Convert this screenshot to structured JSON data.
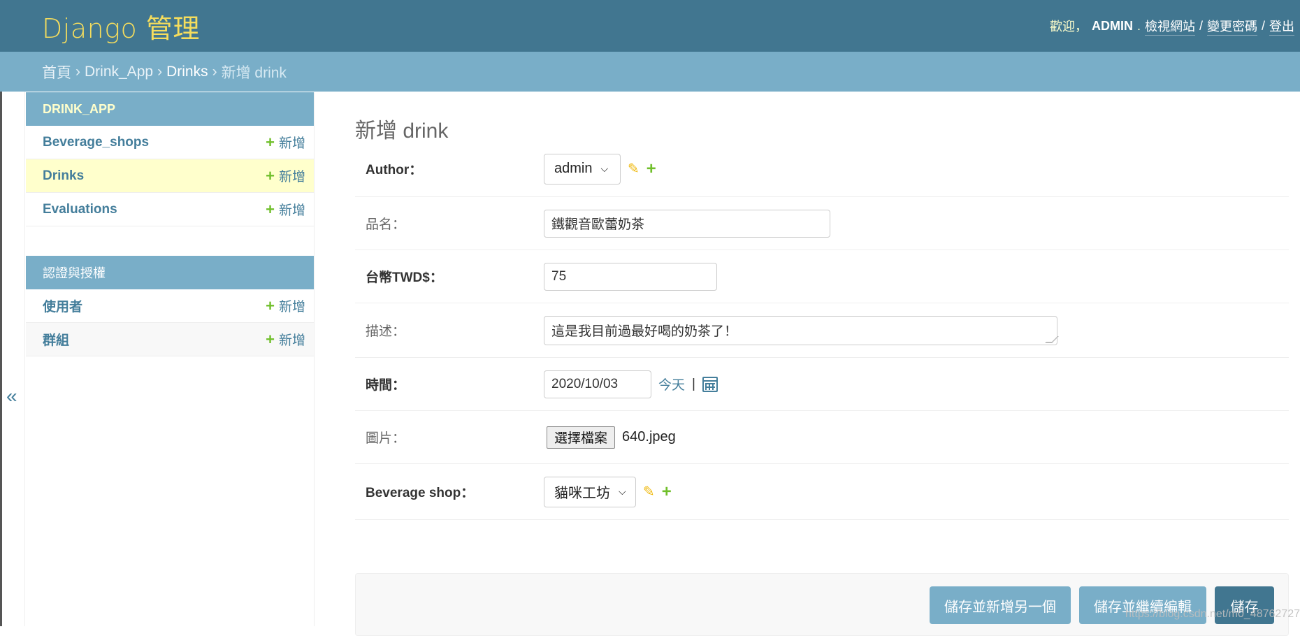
{
  "header": {
    "brand": "Django 管理",
    "welcome": "歡迎，",
    "username": "ADMIN",
    "name_suffix": ".",
    "view_site": "檢視網站",
    "change_password": "變更密碼",
    "logout": "登出",
    "separator": "/"
  },
  "breadcrumbs": {
    "home": "首頁",
    "app": "Drink_App",
    "model": "Drinks",
    "current": "新增 drink",
    "separator": "›"
  },
  "sidebar": {
    "collapse_icon": "«",
    "apps": [
      {
        "caption": "DRINK_APP",
        "models": [
          {
            "name": "Beverage_shops",
            "add": "新增"
          },
          {
            "name": "Drinks",
            "add": "新增",
            "selected": true
          },
          {
            "name": "Evaluations",
            "add": "新增"
          }
        ]
      },
      {
        "caption": "認證與授權",
        "models": [
          {
            "name": "使用者",
            "add": "新增"
          },
          {
            "name": "群組",
            "add": "新增"
          }
        ]
      }
    ]
  },
  "form": {
    "title": "新增 drink",
    "author": {
      "label": "Author：",
      "value": "admin"
    },
    "name": {
      "label": "品名：",
      "value": "鐵觀音歐蕾奶茶"
    },
    "price": {
      "label": "台幣TWD$：",
      "value": "75"
    },
    "description": {
      "label": "描述：",
      "value": "這是我目前過最好喝的奶茶了！"
    },
    "date": {
      "label": "時間：",
      "value": "2020/10/03",
      "today": "今天",
      "bar": "|"
    },
    "image": {
      "label": "圖片：",
      "button": "選擇檔案",
      "filename": "640.jpeg"
    },
    "shop": {
      "label": "Beverage shop：",
      "value": "貓咪工坊"
    }
  },
  "submit": {
    "save_add_another": "儲存並新增另一個",
    "save_continue": "儲存並繼續編輯",
    "save": "儲存"
  },
  "watermark": "https://blog.csdn.net/m0_48762727",
  "colors": {
    "header_bg": "#417690",
    "brand": "#f5dd5d",
    "breadcrumb_bg": "#79aec8",
    "link": "#447e9b",
    "add_green": "#70bf2b",
    "selected_row": "#ffffcc"
  },
  "icons": {
    "edit": "pencil-icon",
    "add": "plus-icon",
    "calendar": "calendar-icon",
    "collapse": "double-chevron-left-icon"
  }
}
